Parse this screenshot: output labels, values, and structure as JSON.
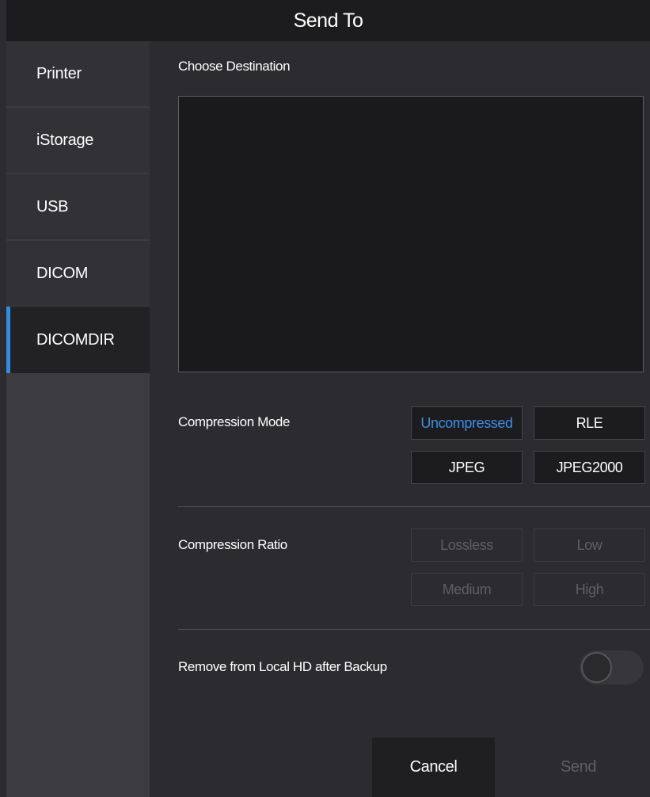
{
  "dialog": {
    "title": "Send To"
  },
  "sidebar": {
    "items": [
      {
        "label": "Printer"
      },
      {
        "label": "iStorage"
      },
      {
        "label": "USB"
      },
      {
        "label": "DICOM"
      },
      {
        "label": "DICOMDIR",
        "active": true
      }
    ]
  },
  "destination": {
    "label": "Choose Destination"
  },
  "compression_mode": {
    "label": "Compression Mode",
    "options": [
      "Uncompressed",
      "RLE",
      "JPEG",
      "JPEG2000"
    ],
    "selected": "Uncompressed"
  },
  "compression_ratio": {
    "label": "Compression Ratio",
    "options": [
      "Lossless",
      "Low",
      "Medium",
      "High"
    ],
    "enabled": false
  },
  "remove_local": {
    "label": "Remove from Local HD after Backup",
    "on": false
  },
  "actions": {
    "cancel_label": "Cancel",
    "send_label": "Send",
    "send_enabled": false
  },
  "colors": {
    "accent": "#2f8de4",
    "background": "#2c2c30",
    "disabled_text": "#5e5e63"
  }
}
